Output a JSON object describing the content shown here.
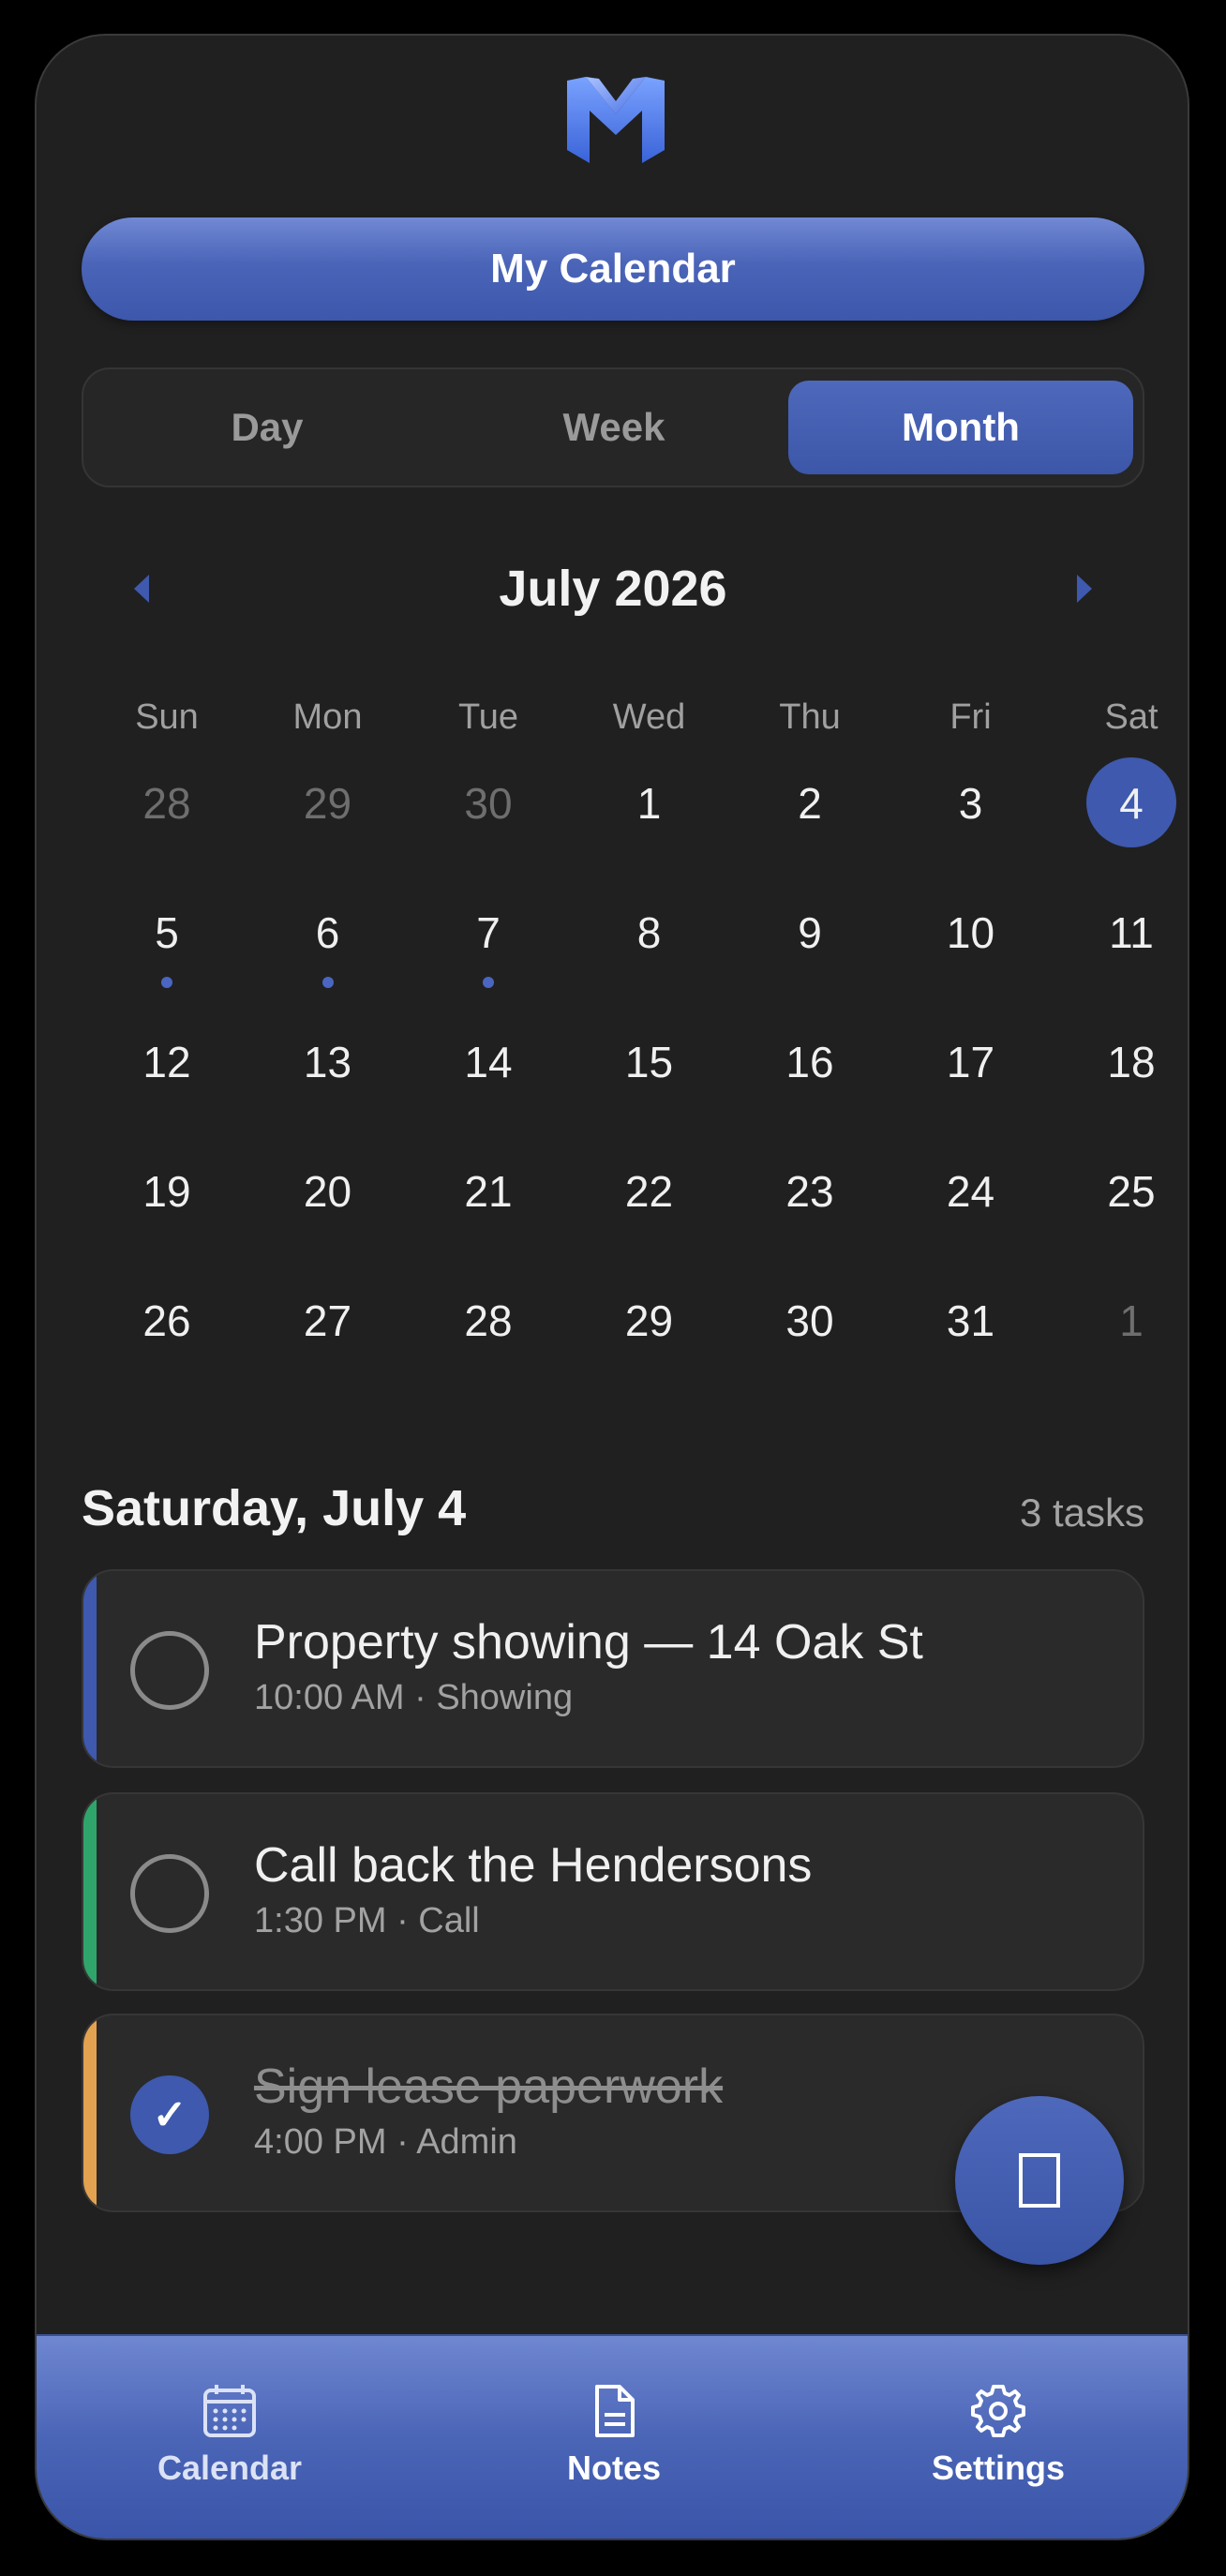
{
  "header": {
    "title": "My Calendar",
    "logo_icon": "m-logo-icon"
  },
  "view_toggle": {
    "options": [
      "Day",
      "Week",
      "Month"
    ],
    "selected": "Month"
  },
  "calendar": {
    "month_label": "July 2026",
    "prev_icon": "chevron-left-icon",
    "next_icon": "chevron-right-icon",
    "weekdays": [
      "Sun",
      "Mon",
      "Tue",
      "Wed",
      "Thu",
      "Fri",
      "Sat"
    ],
    "weeks": [
      [
        {
          "label": "28",
          "muted": true
        },
        {
          "label": "29",
          "muted": true
        },
        {
          "label": "30",
          "muted": true
        },
        {
          "label": "1"
        },
        {
          "label": "2"
        },
        {
          "label": "3"
        },
        {
          "label": "4",
          "selected": true
        }
      ],
      [
        {
          "label": "5",
          "event_dot": true
        },
        {
          "label": "6",
          "event_dot": true
        },
        {
          "label": "7",
          "event_dot": true
        },
        {
          "label": "8"
        },
        {
          "label": "9"
        },
        {
          "label": "10"
        },
        {
          "label": "11"
        }
      ],
      [
        {
          "label": "12"
        },
        {
          "label": "13"
        },
        {
          "label": "14"
        },
        {
          "label": "15"
        },
        {
          "label": "16"
        },
        {
          "label": "17"
        },
        {
          "label": "18"
        }
      ],
      [
        {
          "label": "19"
        },
        {
          "label": "20"
        },
        {
          "label": "21"
        },
        {
          "label": "22"
        },
        {
          "label": "23"
        },
        {
          "label": "24"
        },
        {
          "label": "25"
        }
      ],
      [
        {
          "label": "26"
        },
        {
          "label": "27"
        },
        {
          "label": "28"
        },
        {
          "label": "29"
        },
        {
          "label": "30"
        },
        {
          "label": "31"
        },
        {
          "label": "1",
          "muted": true
        }
      ]
    ]
  },
  "agenda": {
    "date_label": "Saturday, July 4",
    "count_label": "3 tasks",
    "tasks": [
      {
        "title": "Property showing — 14 Oak St",
        "meta": "10:00 AM · Showing",
        "done": false,
        "accent": "#3e59ad"
      },
      {
        "title": "Call back the Hendersons",
        "meta": "1:30 PM · Call",
        "done": false,
        "accent": "#2fa56b"
      },
      {
        "title": "Sign lease paperwork",
        "meta": "4:00 PM · Admin",
        "done": true,
        "accent": "#e3a24f"
      }
    ]
  },
  "fab": {
    "icon": "add-note-icon"
  },
  "bottom_nav": {
    "items": [
      {
        "label": "Calendar",
        "icon": "calendar-icon",
        "active": false
      },
      {
        "label": "Notes",
        "icon": "notes-icon",
        "active": true
      },
      {
        "label": "Settings",
        "icon": "gear-icon",
        "active": true
      }
    ]
  },
  "colors": {
    "accent": "#3e59ad",
    "background": "#202020",
    "card": "#2a2a2a"
  }
}
